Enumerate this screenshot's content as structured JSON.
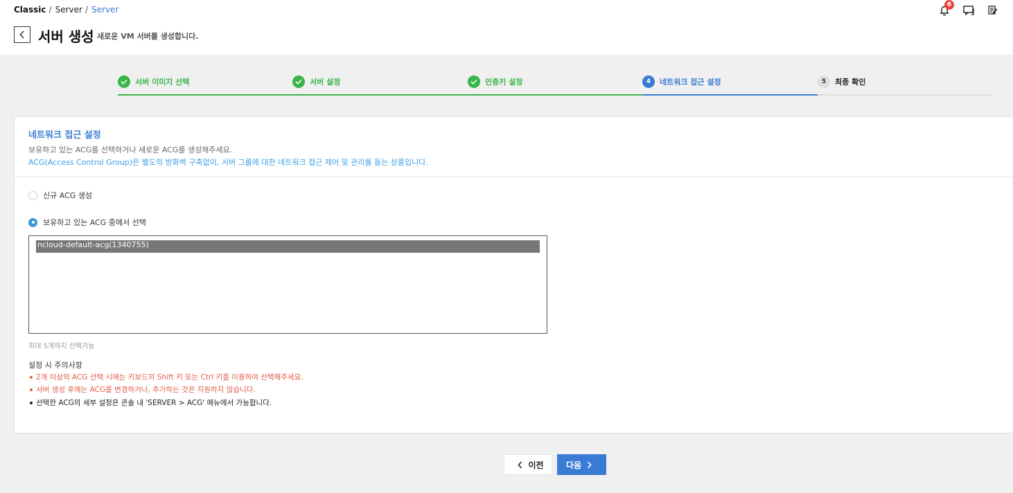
{
  "breadcrumb": {
    "root": "Classic",
    "middle": "Server",
    "current": "Server",
    "separator": "/"
  },
  "notifications": {
    "count": "6"
  },
  "header_icons": [
    "bell-icon",
    "chat-icon",
    "edit-icon"
  ],
  "page": {
    "title": "서버 생성",
    "description": "새로운 VM 서버를 생성합니다."
  },
  "steps": [
    {
      "label": "서버 이미지 선택",
      "status": "done"
    },
    {
      "label": "서버 설정",
      "status": "done"
    },
    {
      "label": "인증키 설정",
      "status": "done"
    },
    {
      "number": "4",
      "label": "네트워크 접근 설정",
      "status": "active"
    },
    {
      "number": "5",
      "label": "최종 확인",
      "status": "pending"
    }
  ],
  "section": {
    "title": "네트워크 접근 설정",
    "desc1": "보유하고 있는 ACG를 선택하거나 새로운 ACG를 생성해주세요.",
    "desc2": "ACG(Access Control Group)은 별도의 방화벽 구축없이, 서버 그룹에 대한 네트워크 접근 제어 및 관리를 돕는 상품입니다."
  },
  "options": {
    "new_acg": "신규 ACG 생성",
    "existing_acg": "보유하고 있는 ACG 중에서 선택",
    "selected": "existing_acg"
  },
  "acg_list": {
    "items": [
      "ncloud-default-acg(1340755)"
    ],
    "selected_index": 0,
    "hint": "최대 5개까지 선택가능"
  },
  "notes": {
    "title": "설정 시 주의사항",
    "items": [
      {
        "text": "2개 이상의 ACG 선택 시에는 키보드의 Shift 키 또는 Ctrl 키를 이용하여 선택해주세요.",
        "type": "warn"
      },
      {
        "text": "서버 생성 후에는 ACG를 변경하거나, 추가하는 것은 지원하지 않습니다.",
        "type": "warn"
      },
      {
        "text": "선택한 ACG의 세부 설정은 콘솔 내 'SERVER > ACG' 메뉴에서 가능합니다.",
        "type": "info"
      }
    ]
  },
  "buttons": {
    "prev": "이전",
    "next": "다음"
  },
  "colors": {
    "accent": "#3a7bd5",
    "done": "#39b54a",
    "warning": "#e25b45",
    "badge": "#e8453c"
  }
}
